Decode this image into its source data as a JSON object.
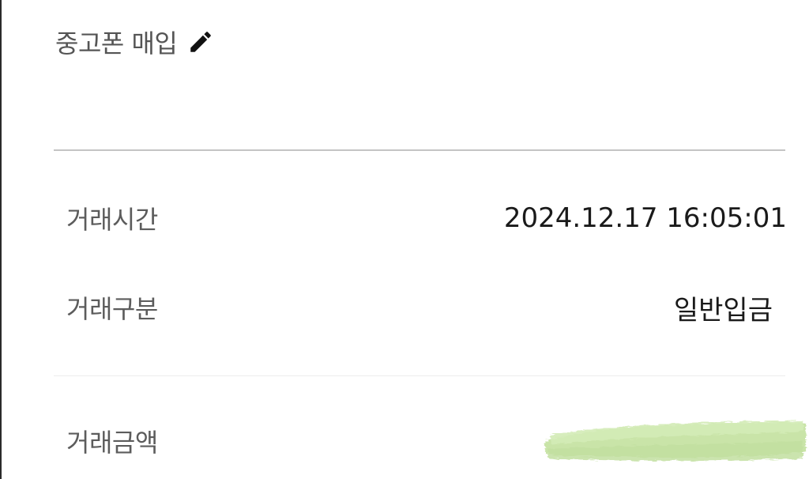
{
  "header": {
    "memo_title": "중고폰 매입",
    "edit_icon": "pencil-icon"
  },
  "details": {
    "transaction_time_label": "거래시간",
    "transaction_time_value": "2024.12.17 16:05:01",
    "transaction_type_label": "거래구분",
    "transaction_type_value": "일반입금",
    "transaction_amount_label": "거래금액"
  },
  "colors": {
    "redaction_marker": "#c9e4a8"
  }
}
